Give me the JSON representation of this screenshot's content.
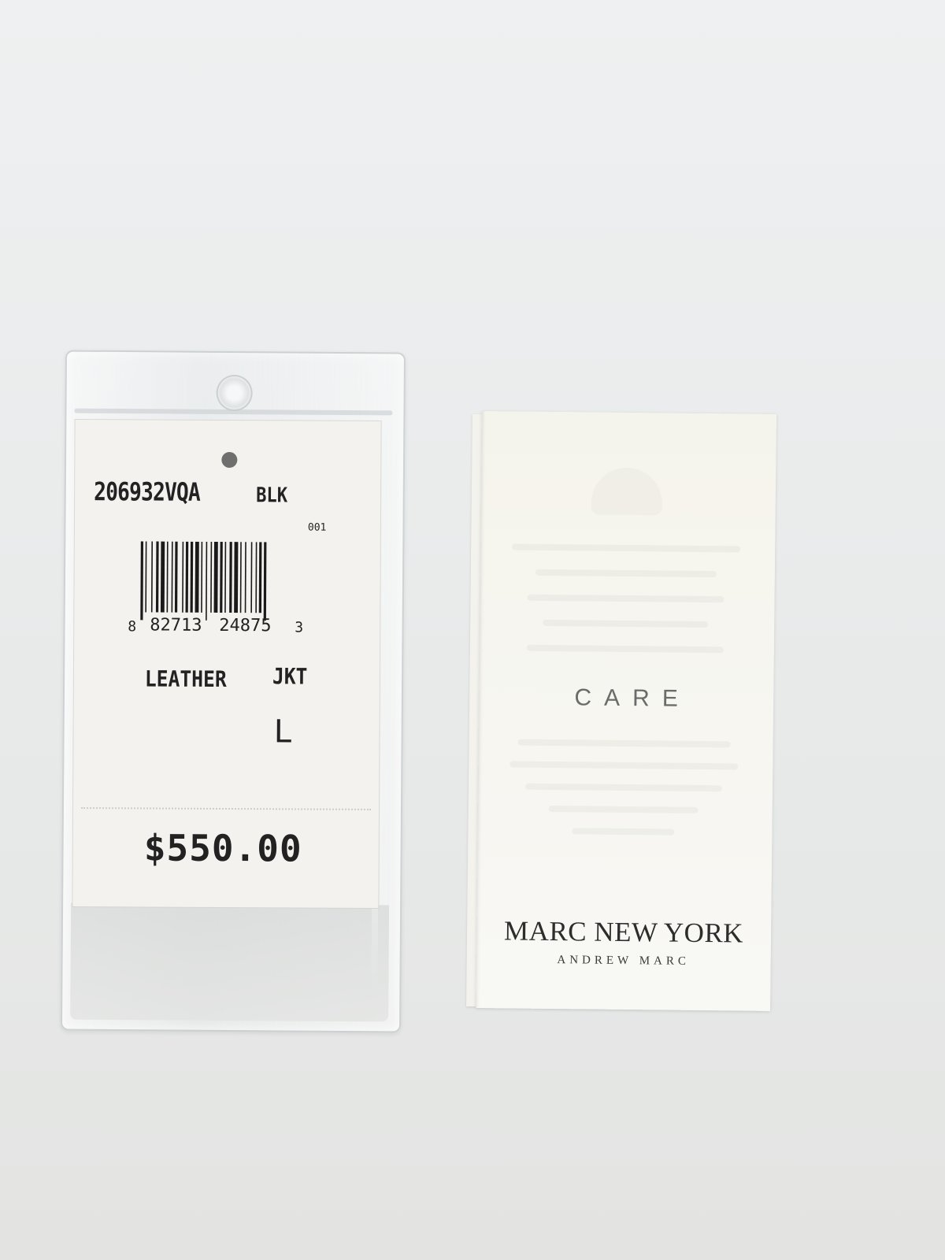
{
  "price_tag": {
    "style_code": "206932VQA",
    "color_code": "BLK",
    "sub_code": "001",
    "barcode": {
      "first_digit": "8",
      "left_group": "82713",
      "right_group": "24875",
      "check_digit": "3"
    },
    "description": "LEATHER",
    "garment_type": "JKT",
    "size": "L",
    "price": "$550.00"
  },
  "care_booklet": {
    "title": "CARE",
    "brand": "MARC NEW YORK",
    "sub_brand": "ANDREW MARC"
  },
  "colors": {
    "background": "#e8eaea",
    "tag_paper": "#f4f2ee",
    "booklet_paper": "#f7f6f1",
    "ink": "#1d1d1d",
    "care_title": "#6b6b6b"
  }
}
